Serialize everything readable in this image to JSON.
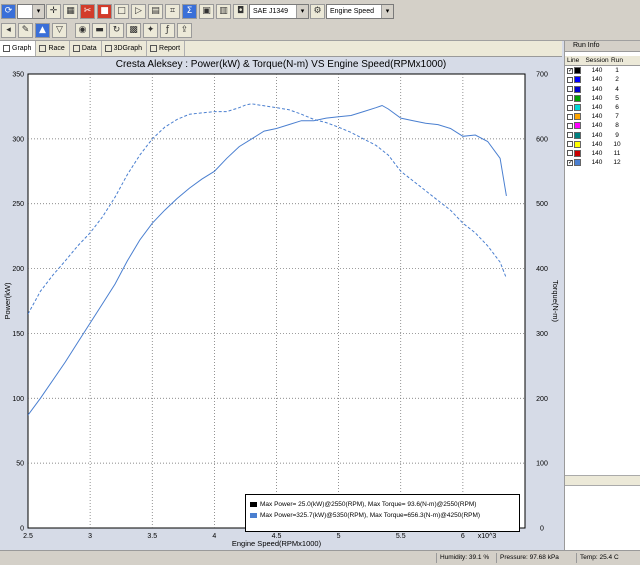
{
  "toolbar": {
    "standard_select": "SAE J1349",
    "axis_select": "Engine Speed",
    "icons": [
      "save-icon",
      "open-icon",
      "back-icon",
      "forward-icon",
      "zoom-icon",
      "table-icon",
      "overlay-icon",
      "print-icon",
      "setup-icon",
      "camera-icon",
      "gauge-icon",
      "filter-icon",
      "flag-icon",
      "tools-icon",
      "function-icon",
      "export-icon"
    ]
  },
  "tabs": [
    {
      "label": "Graph",
      "icon": "graph-icon",
      "active": true
    },
    {
      "label": "Race",
      "icon": "race-icon",
      "active": false
    },
    {
      "label": "Data",
      "icon": "data-icon",
      "active": false
    },
    {
      "label": "3DGraph",
      "icon": "3d-graph-icon",
      "active": false
    },
    {
      "label": "Report",
      "icon": "report-icon",
      "active": false
    }
  ],
  "chart_data": {
    "type": "line",
    "title": "Cresta Aleksey : Power(kW) & Torque(N-m) VS Engine Speed(RPMx1000)",
    "xlabel": "Engine Speed(RPMx1000)",
    "ylabel": "Power(kW)",
    "y2label": "Torque(N-m)",
    "x_multiplier_label": "x10^3",
    "xlim": [
      2.5,
      6.5
    ],
    "ylim": [
      0,
      350
    ],
    "y2lim": [
      0,
      700
    ],
    "x_ticks": [
      "2.5",
      "3",
      "3.5",
      "4",
      "4.5",
      "5",
      "5.5",
      "6"
    ],
    "y_ticks": [
      "0",
      "50",
      "100",
      "150",
      "200",
      "250",
      "300",
      "350"
    ],
    "y2_ticks": [
      "0",
      "100",
      "200",
      "300",
      "400",
      "500",
      "600",
      "700"
    ],
    "grid": true,
    "series": [
      {
        "name": "Power",
        "axis": "left",
        "style": "solid",
        "color": "#4a7fd0",
        "x": [
          2.5,
          2.6,
          2.7,
          2.8,
          2.9,
          3.0,
          3.1,
          3.2,
          3.3,
          3.4,
          3.5,
          3.6,
          3.7,
          3.8,
          3.9,
          4.0,
          4.1,
          4.2,
          4.3,
          4.4,
          4.5,
          4.6,
          4.7,
          4.8,
          4.9,
          5.0,
          5.1,
          5.2,
          5.3,
          5.35,
          5.4,
          5.5,
          5.6,
          5.7,
          5.8,
          5.9,
          6.0,
          6.1,
          6.2,
          6.3,
          6.35
        ],
        "values": [
          87,
          100,
          114,
          128,
          143,
          158,
          173,
          188,
          206,
          222,
          235,
          245,
          254,
          262,
          269,
          275,
          285,
          294,
          300,
          306,
          308,
          311,
          314,
          314,
          316,
          317,
          318,
          321,
          324,
          325.7,
          323,
          316,
          314,
          312,
          311,
          308,
          302,
          303,
          298,
          285,
          256
        ]
      },
      {
        "name": "Torque",
        "axis": "right",
        "style": "dashed",
        "color": "#4a7fd0",
        "x": [
          2.5,
          2.6,
          2.7,
          2.8,
          2.9,
          3.0,
          3.1,
          3.2,
          3.3,
          3.4,
          3.5,
          3.6,
          3.7,
          3.8,
          3.9,
          4.0,
          4.1,
          4.2,
          4.25,
          4.3,
          4.4,
          4.5,
          4.6,
          4.7,
          4.8,
          4.9,
          5.0,
          5.1,
          5.2,
          5.3,
          5.4,
          5.5,
          5.6,
          5.7,
          5.8,
          5.9,
          6.0,
          6.1,
          6.2,
          6.3,
          6.35
        ],
        "values": [
          330,
          365,
          390,
          412,
          435,
          455,
          480,
          510,
          545,
          575,
          600,
          618,
          630,
          638,
          640,
          642,
          642,
          648,
          652,
          654,
          651,
          648,
          645,
          638,
          630,
          625,
          618,
          610,
          600,
          590,
          575,
          550,
          535,
          520,
          505,
          490,
          470,
          455,
          435,
          410,
          385
        ]
      }
    ],
    "legend": [
      {
        "color": "#000000",
        "text": "Max Power= 25.0(kW)@2550(RPM), Max Torque= 93.6(N-m)@2550(RPM)"
      },
      {
        "color": "#4a7fd0",
        "text": "Max Power=325.7(kW)@5350(RPM), Max Torque=656.3(N-m)@4250(RPM)"
      }
    ],
    "legend_position": "bottom-right"
  },
  "run_info": {
    "title": "Run Info",
    "headers": [
      "Line",
      "Session",
      "Run"
    ],
    "rows": [
      {
        "checked": true,
        "color": "#000000",
        "session": "140",
        "run": "1"
      },
      {
        "checked": false,
        "color": "#0000ff",
        "session": "140",
        "run": "2"
      },
      {
        "checked": false,
        "color": "#0000cc",
        "session": "140",
        "run": "4"
      },
      {
        "checked": false,
        "color": "#00a000",
        "session": "140",
        "run": "5"
      },
      {
        "checked": false,
        "color": "#00d8d8",
        "session": "140",
        "run": "6"
      },
      {
        "checked": false,
        "color": "#ffa500",
        "session": "140",
        "run": "7"
      },
      {
        "checked": false,
        "color": "#ff00ff",
        "session": "140",
        "run": "8"
      },
      {
        "checked": false,
        "color": "#008080",
        "session": "140",
        "run": "9"
      },
      {
        "checked": false,
        "color": "#ffff00",
        "session": "140",
        "run": "10"
      },
      {
        "checked": false,
        "color": "#cc0000",
        "session": "140",
        "run": "11"
      },
      {
        "checked": true,
        "color": "#4a7fd0",
        "session": "140",
        "run": "12"
      }
    ]
  },
  "status": {
    "humidity": "Humidity: 39.1 %",
    "pressure": "Pressure: 97.68 kPa",
    "temp": "Temp: 25.4 C"
  }
}
